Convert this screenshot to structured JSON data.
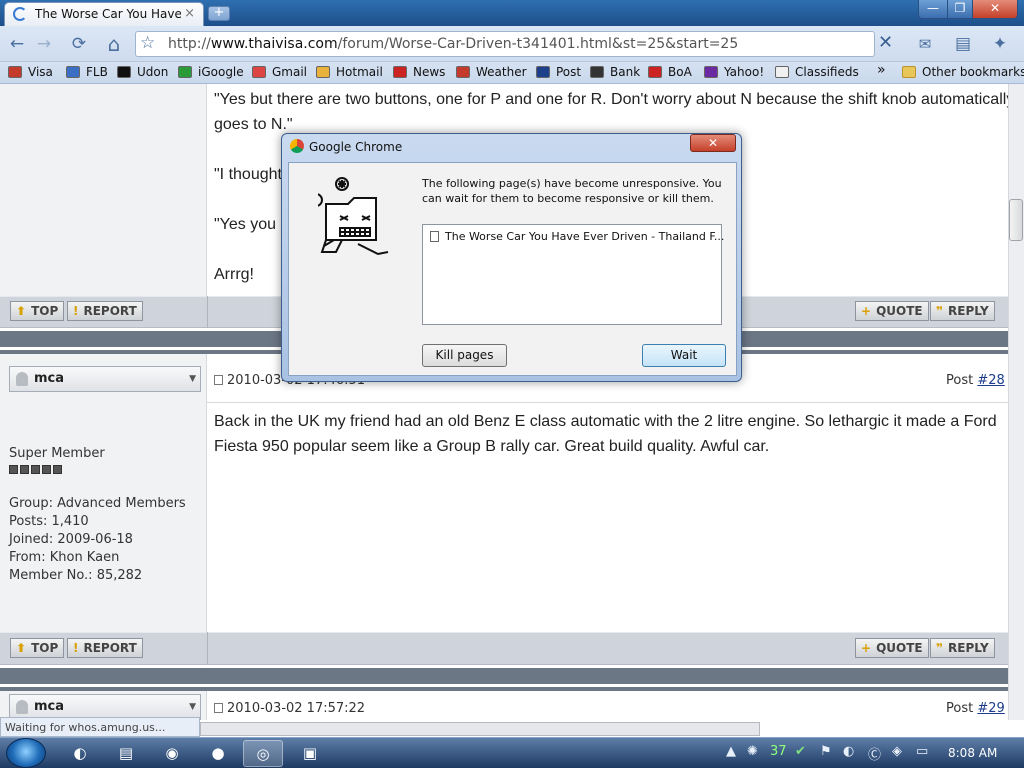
{
  "browser": {
    "tab_title": "The Worse Car You Have ...",
    "tab_close": "×",
    "new_tab": "+",
    "url_prefix": "http://",
    "url_host": "www.thaivisa.com",
    "url_path": "/forum/Worse-Car-Driven-t341401.html&st=25&start=25",
    "nav_back": "←",
    "nav_forward": "→",
    "nav_reload": "⟳",
    "nav_home": "⌂",
    "star": "☆",
    "stop": "✕",
    "menu_mail": "✉",
    "menu_page": "▤",
    "menu_wrench": "✦",
    "window_min": "—",
    "window_max": "❐",
    "window_close": "✕"
  },
  "bookmarks": {
    "items": [
      "Visa",
      "FLB",
      "Udon",
      "iGoogle",
      "Gmail",
      "Hotmail",
      "News",
      "Weather",
      "Post",
      "Bank",
      "BoA",
      "Yahoo!",
      "Classifieds"
    ],
    "more": "»",
    "other": "Other bookmarks"
  },
  "forum": {
    "prev_post_lines": [
      "\"Yes but there are two buttons, one for P and one for R. Don't worry about N because the shift knob automatically",
      "goes to N.\"",
      "\"I thought",
      "\"Yes you a",
      "Arrrg!"
    ],
    "btn_top": "TOP",
    "btn_report": "REPORT",
    "btn_quote": "QUOTE",
    "btn_reply": "REPLY",
    "post28": {
      "username": "mca",
      "date": "2010-03-02 17:46:51",
      "post_label": "Post ",
      "post_number": "#28",
      "body_line1": "Back in the UK my friend had an old Benz E class automatic with the 2 litre engine. So lethargic it made a Ford",
      "body_line2": "Fiesta 950 popular seem like a Group B rally car. Great build quality. Awful car.",
      "rank": "Super Member",
      "group": "Group: Advanced Members",
      "posts": "Posts: 1,410",
      "joined": "Joined: 2009-06-18",
      "from": "From: Khon Kaen",
      "member_no": "Member No.: 85,282"
    },
    "post29": {
      "username": "mca",
      "date": "2010-03-02 17:57:22",
      "post_label": "Post ",
      "post_number": "#29"
    }
  },
  "dialog": {
    "title": "Google Chrome",
    "close": "✕",
    "message": "The following page(s) have become unresponsive. You can wait for them to become responsive or kill them.",
    "list_item": "The Worse Car You Have Ever Driven - Thailand F...",
    "kill_label": "Kill pages",
    "wait_label": "Wait"
  },
  "status": {
    "text": "Waiting for whos.amung.us..."
  },
  "taskbar": {
    "clock": "8:08 AM",
    "tray_count": "37"
  }
}
